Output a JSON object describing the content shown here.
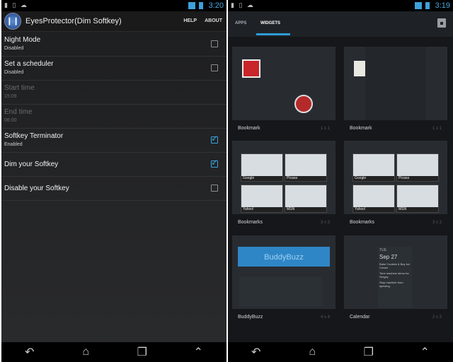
{
  "left": {
    "status": {
      "time": "3:20"
    },
    "app": {
      "title": "EyesProtector(Dim Softkey)",
      "help": "HELP",
      "about": "ABOUT"
    },
    "prefs": [
      {
        "title": "Night Mode",
        "summary": "Disabled",
        "checked": false,
        "dim": false
      },
      {
        "title": "Set a scheduler",
        "summary": "Disabled",
        "checked": false,
        "dim": false
      },
      {
        "title": "Start time",
        "summary": "15:09",
        "checked": null,
        "dim": true
      },
      {
        "title": "End time",
        "summary": "06:00",
        "checked": null,
        "dim": true
      },
      {
        "title": "Softkey Terminator",
        "summary": "Enabled",
        "checked": true,
        "dim": false
      },
      {
        "title": "Dim your Softkey",
        "summary": "",
        "checked": true,
        "dim": false
      },
      {
        "title": "Disable your Softkey",
        "summary": "",
        "checked": false,
        "dim": false
      }
    ]
  },
  "right": {
    "status": {
      "time": "3:19"
    },
    "tabs": {
      "apps": "APPS",
      "widgets": "WIDGETS"
    },
    "widgets": [
      {
        "label": "Bookmark",
        "size": "1 x 1"
      },
      {
        "label": "Bookmark",
        "size": "1 x 1"
      },
      {
        "label": "Bookmarks",
        "size": "3 x 3"
      },
      {
        "label": "Bookmarks",
        "size": "3 x 3"
      },
      {
        "label": "BuddyBuzz",
        "size": "4 x 4"
      },
      {
        "label": "Calendar",
        "size": "2 x 3"
      }
    ],
    "previews": {
      "bookmarks_a": [
        "Google",
        "Picasa",
        "Yahoo!",
        "MSN"
      ],
      "bookmarks_b": [
        "Google",
        "Picasa",
        "Yahoo!",
        "MSN"
      ],
      "buddybuzz_header": "BuddyBuzz",
      "calendar_day": "TUE",
      "calendar_date": "Sep 27",
      "calendar_events": [
        "Bake Cookies & Buy Ice Cream",
        "Time machine demo for Sergey",
        "Stop machine from spewing"
      ]
    }
  }
}
